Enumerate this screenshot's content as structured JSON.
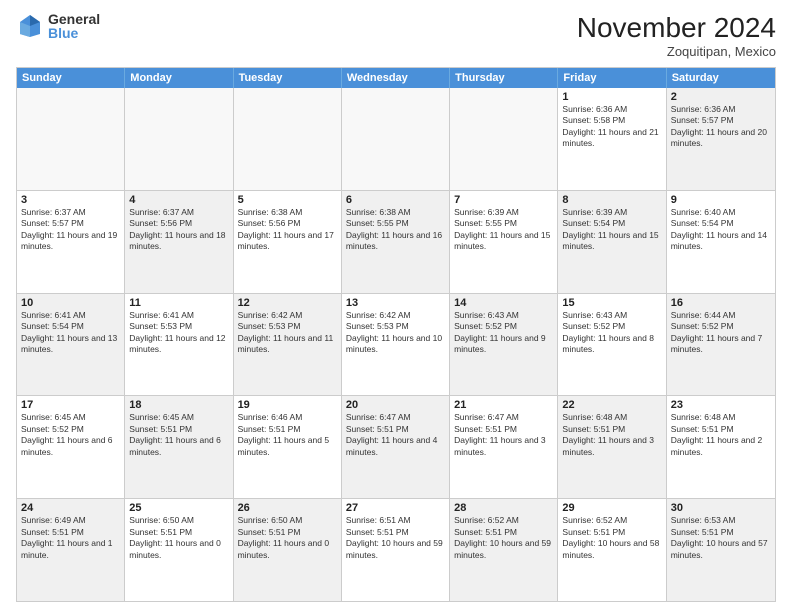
{
  "logo": {
    "general": "General",
    "blue": "Blue"
  },
  "title": "November 2024",
  "location": "Zoquitipan, Mexico",
  "days": [
    "Sunday",
    "Monday",
    "Tuesday",
    "Wednesday",
    "Thursday",
    "Friday",
    "Saturday"
  ],
  "rows": [
    [
      {
        "day": "",
        "text": "",
        "shaded": false,
        "empty": true
      },
      {
        "day": "",
        "text": "",
        "shaded": false,
        "empty": true
      },
      {
        "day": "",
        "text": "",
        "shaded": false,
        "empty": true
      },
      {
        "day": "",
        "text": "",
        "shaded": false,
        "empty": true
      },
      {
        "day": "",
        "text": "",
        "shaded": false,
        "empty": true
      },
      {
        "day": "1",
        "text": "Sunrise: 6:36 AM\nSunset: 5:58 PM\nDaylight: 11 hours and 21 minutes.",
        "shaded": false,
        "empty": false
      },
      {
        "day": "2",
        "text": "Sunrise: 6:36 AM\nSunset: 5:57 PM\nDaylight: 11 hours and 20 minutes.",
        "shaded": true,
        "empty": false
      }
    ],
    [
      {
        "day": "3",
        "text": "Sunrise: 6:37 AM\nSunset: 5:57 PM\nDaylight: 11 hours and 19 minutes.",
        "shaded": false,
        "empty": false
      },
      {
        "day": "4",
        "text": "Sunrise: 6:37 AM\nSunset: 5:56 PM\nDaylight: 11 hours and 18 minutes.",
        "shaded": true,
        "empty": false
      },
      {
        "day": "5",
        "text": "Sunrise: 6:38 AM\nSunset: 5:56 PM\nDaylight: 11 hours and 17 minutes.",
        "shaded": false,
        "empty": false
      },
      {
        "day": "6",
        "text": "Sunrise: 6:38 AM\nSunset: 5:55 PM\nDaylight: 11 hours and 16 minutes.",
        "shaded": true,
        "empty": false
      },
      {
        "day": "7",
        "text": "Sunrise: 6:39 AM\nSunset: 5:55 PM\nDaylight: 11 hours and 15 minutes.",
        "shaded": false,
        "empty": false
      },
      {
        "day": "8",
        "text": "Sunrise: 6:39 AM\nSunset: 5:54 PM\nDaylight: 11 hours and 15 minutes.",
        "shaded": true,
        "empty": false
      },
      {
        "day": "9",
        "text": "Sunrise: 6:40 AM\nSunset: 5:54 PM\nDaylight: 11 hours and 14 minutes.",
        "shaded": false,
        "empty": false
      }
    ],
    [
      {
        "day": "10",
        "text": "Sunrise: 6:41 AM\nSunset: 5:54 PM\nDaylight: 11 hours and 13 minutes.",
        "shaded": true,
        "empty": false
      },
      {
        "day": "11",
        "text": "Sunrise: 6:41 AM\nSunset: 5:53 PM\nDaylight: 11 hours and 12 minutes.",
        "shaded": false,
        "empty": false
      },
      {
        "day": "12",
        "text": "Sunrise: 6:42 AM\nSunset: 5:53 PM\nDaylight: 11 hours and 11 minutes.",
        "shaded": true,
        "empty": false
      },
      {
        "day": "13",
        "text": "Sunrise: 6:42 AM\nSunset: 5:53 PM\nDaylight: 11 hours and 10 minutes.",
        "shaded": false,
        "empty": false
      },
      {
        "day": "14",
        "text": "Sunrise: 6:43 AM\nSunset: 5:52 PM\nDaylight: 11 hours and 9 minutes.",
        "shaded": true,
        "empty": false
      },
      {
        "day": "15",
        "text": "Sunrise: 6:43 AM\nSunset: 5:52 PM\nDaylight: 11 hours and 8 minutes.",
        "shaded": false,
        "empty": false
      },
      {
        "day": "16",
        "text": "Sunrise: 6:44 AM\nSunset: 5:52 PM\nDaylight: 11 hours and 7 minutes.",
        "shaded": true,
        "empty": false
      }
    ],
    [
      {
        "day": "17",
        "text": "Sunrise: 6:45 AM\nSunset: 5:52 PM\nDaylight: 11 hours and 6 minutes.",
        "shaded": false,
        "empty": false
      },
      {
        "day": "18",
        "text": "Sunrise: 6:45 AM\nSunset: 5:51 PM\nDaylight: 11 hours and 6 minutes.",
        "shaded": true,
        "empty": false
      },
      {
        "day": "19",
        "text": "Sunrise: 6:46 AM\nSunset: 5:51 PM\nDaylight: 11 hours and 5 minutes.",
        "shaded": false,
        "empty": false
      },
      {
        "day": "20",
        "text": "Sunrise: 6:47 AM\nSunset: 5:51 PM\nDaylight: 11 hours and 4 minutes.",
        "shaded": true,
        "empty": false
      },
      {
        "day": "21",
        "text": "Sunrise: 6:47 AM\nSunset: 5:51 PM\nDaylight: 11 hours and 3 minutes.",
        "shaded": false,
        "empty": false
      },
      {
        "day": "22",
        "text": "Sunrise: 6:48 AM\nSunset: 5:51 PM\nDaylight: 11 hours and 3 minutes.",
        "shaded": true,
        "empty": false
      },
      {
        "day": "23",
        "text": "Sunrise: 6:48 AM\nSunset: 5:51 PM\nDaylight: 11 hours and 2 minutes.",
        "shaded": false,
        "empty": false
      }
    ],
    [
      {
        "day": "24",
        "text": "Sunrise: 6:49 AM\nSunset: 5:51 PM\nDaylight: 11 hours and 1 minute.",
        "shaded": true,
        "empty": false
      },
      {
        "day": "25",
        "text": "Sunrise: 6:50 AM\nSunset: 5:51 PM\nDaylight: 11 hours and 0 minutes.",
        "shaded": false,
        "empty": false
      },
      {
        "day": "26",
        "text": "Sunrise: 6:50 AM\nSunset: 5:51 PM\nDaylight: 11 hours and 0 minutes.",
        "shaded": true,
        "empty": false
      },
      {
        "day": "27",
        "text": "Sunrise: 6:51 AM\nSunset: 5:51 PM\nDaylight: 10 hours and 59 minutes.",
        "shaded": false,
        "empty": false
      },
      {
        "day": "28",
        "text": "Sunrise: 6:52 AM\nSunset: 5:51 PM\nDaylight: 10 hours and 59 minutes.",
        "shaded": true,
        "empty": false
      },
      {
        "day": "29",
        "text": "Sunrise: 6:52 AM\nSunset: 5:51 PM\nDaylight: 10 hours and 58 minutes.",
        "shaded": false,
        "empty": false
      },
      {
        "day": "30",
        "text": "Sunrise: 6:53 AM\nSunset: 5:51 PM\nDaylight: 10 hours and 57 minutes.",
        "shaded": true,
        "empty": false
      }
    ]
  ]
}
